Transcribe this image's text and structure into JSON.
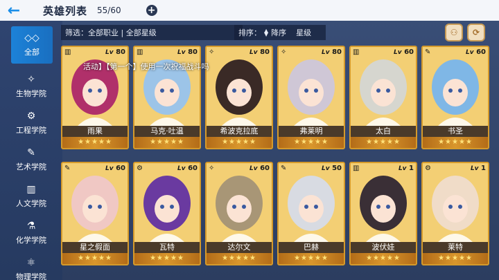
{
  "header": {
    "title": "英雄列表",
    "count": "55/60"
  },
  "filter": {
    "text": "筛选：全部职业 | 全部星级"
  },
  "sort": {
    "label": "排序：",
    "order": "降序",
    "field": "星级"
  },
  "overlay": {
    "text": "活动】【第一个】使用一次祝福战斗吗"
  },
  "sidebar": {
    "items": [
      {
        "label": "全部",
        "icon": "all-icon"
      },
      {
        "label": "生物学院",
        "icon": "dna-icon"
      },
      {
        "label": "工程学院",
        "icon": "robot-icon"
      },
      {
        "label": "艺术学院",
        "icon": "palette-icon"
      },
      {
        "label": "人文学院",
        "icon": "book-icon"
      },
      {
        "label": "化学学院",
        "icon": "flask-icon"
      },
      {
        "label": "物理学院",
        "icon": "atom-icon"
      }
    ]
  },
  "colors": {
    "accent": "#1c82d8",
    "card_gold": "#e9b54b",
    "name_bar": "#4a3a2a"
  },
  "cards": [
    {
      "name": "雨果",
      "lv": "80",
      "stars": "★★★★★",
      "class_icon": "book-icon",
      "hue": "#b0306a"
    },
    {
      "name": "马克·吐温",
      "lv": "80",
      "stars": "★★★★★",
      "class_icon": "book-icon",
      "hue": "#9cc4e8"
    },
    {
      "name": "希波克拉底",
      "lv": "80",
      "stars": "★★★★★",
      "class_icon": "dna-icon",
      "hue": "#3a2a26"
    },
    {
      "name": "弗莱明",
      "lv": "80",
      "stars": "★★★★★",
      "class_icon": "dna-icon",
      "hue": "#cfc7d6"
    },
    {
      "name": "太白",
      "lv": "60",
      "stars": "★★★★★",
      "class_icon": "book-icon",
      "hue": "#d6d6cf"
    },
    {
      "name": "书圣",
      "lv": "60",
      "stars": "★★★★★",
      "class_icon": "palette-icon",
      "hue": "#7fb7e6"
    },
    {
      "name": "星之假面",
      "lv": "60",
      "stars": "★★★★★",
      "class_icon": "palette-icon",
      "hue": "#f0c8c4"
    },
    {
      "name": "瓦特",
      "lv": "60",
      "stars": "★★★★★",
      "class_icon": "robot-icon",
      "hue": "#6a3aa0"
    },
    {
      "name": "达尔文",
      "lv": "60",
      "stars": "★★★★★",
      "class_icon": "dna-icon",
      "hue": "#a89676"
    },
    {
      "name": "巴赫",
      "lv": "50",
      "stars": "★★★★★",
      "class_icon": "palette-icon",
      "hue": "#d8dbe2"
    },
    {
      "name": "波伏娃",
      "lv": "1",
      "stars": "★★★★★",
      "class_icon": "book-icon",
      "hue": "#3a2f36"
    },
    {
      "name": "莱特",
      "lv": "1",
      "stars": "★★★★★",
      "class_icon": "robot-icon",
      "hue": "#f0dcc8"
    }
  ]
}
